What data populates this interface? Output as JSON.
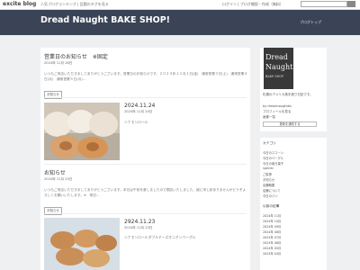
{
  "topbar": {
    "logo": "excite blog",
    "message": "人気ブログランキング | 話題のタグを見る",
    "links": "ログイン | ブログ開設・作成（無料）",
    "search_placeholder": ""
  },
  "header": {
    "title": "Dread Naught BAKE SHOP!",
    "link": "ブログトップ"
  },
  "posts": [
    {
      "title": "営業日のお知らせ　※固定",
      "date": "2024年 11月 26日",
      "body1": "いつもご来店いただきましてありがとうございます。営業日のお知らせです。２０２４年１１月１日(金)　通常営業３日(土)　通常営業４日(月)　通常営業５日(月)...",
      "tag": "お知らせ"
    },
    {
      "title": "2024.11.24",
      "date": "2024年 11月 24日",
      "body": "シナモンロール"
    },
    {
      "title": "お知らせ",
      "date": "2024年 11月 23日",
      "body1": "いつもご来店いただきましてありがとうございます。本日は午前を食しましたので閉店いたしました。誠に申し訳ありませんがどうぞよろしくお願いいたします。※　明日...",
      "tag": "お知らせ"
    },
    {
      "title": "2924.11.23",
      "date": "2024年 11月 23日",
      "body": "シナモンロールダブルチーズオニオンベーグル"
    }
  ],
  "side": {
    "logo_line1": "Dread",
    "logo_line2": "Naught",
    "logo_sub": "BAKE SHOP",
    "desc": "札幌のアメリカ風手造り日記です。",
    "author": "by dreadnaughtbs",
    "profile": "プロフィールを見る",
    "edit": "画像一覧",
    "button": "更新を通知する",
    "category_title": "カテゴリ",
    "categories": [
      "今日のスコーン",
      "今日のベーグル",
      "今日の焼き菓子",
      "special",
      "ご挨拶",
      "お知らせ",
      "店舗概要",
      "店舗について",
      "今日のパン"
    ],
    "recent_title": "以前の記事",
    "recent": [
      "2024年 11月",
      "2024年 10月",
      "2024年 09月",
      "2024年 08月",
      "2024年 07月",
      "2024年 06月",
      "2024年 05月",
      "2024年 04月"
    ]
  },
  "colors": {
    "header_bg": "#3b4456",
    "page_bg": "#eef0f2"
  }
}
